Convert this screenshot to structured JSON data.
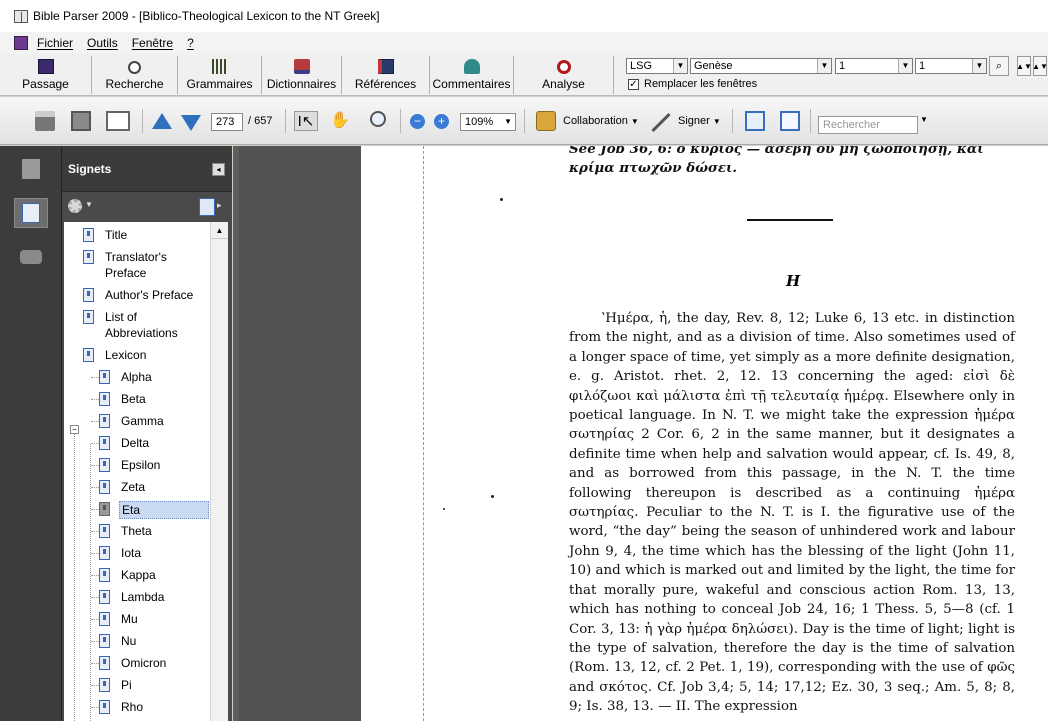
{
  "window": {
    "title": "Bible Parser 2009 - [Biblico-Theological Lexicon to the NT Greek]"
  },
  "menu": {
    "items": [
      "Fichier",
      "Outils",
      "Fenêtre",
      "?"
    ]
  },
  "app_toolbar": {
    "buttons": [
      {
        "label": "Passage",
        "icon": "book-icon"
      },
      {
        "label": "Recherche",
        "icon": "search-icon"
      },
      {
        "label": "Grammaires",
        "icon": "grammar-icon"
      },
      {
        "label": "Dictionnaires",
        "icon": "dictionary-icon"
      },
      {
        "label": "Références",
        "icon": "references-icon"
      },
      {
        "label": "Commentaires",
        "icon": "commentary-icon"
      },
      {
        "label": "Analyse",
        "icon": "analyse-icon"
      }
    ],
    "version_select": "LSG",
    "book_select": "Genèse",
    "chapter_select": "1",
    "verse_select": "1",
    "replace_windows_label": "Remplacer les fenêtres",
    "replace_windows_checked": true
  },
  "pdf_toolbar": {
    "current_page": "273",
    "total_pages": "/ 657",
    "zoom": "109%",
    "collaboration_label": "Collaboration",
    "sign_label": "Signer",
    "search_placeholder": "Rechercher"
  },
  "bookmarks": {
    "title": "Signets",
    "items": [
      {
        "label": "Title",
        "level": 0
      },
      {
        "label": "Translator's Preface",
        "level": 0
      },
      {
        "label": "Author's Preface",
        "level": 0
      },
      {
        "label": "List of Abbreviations",
        "level": 0
      },
      {
        "label": "Lexicon",
        "level": 0,
        "expanded": true
      },
      {
        "label": "Alpha",
        "level": 1
      },
      {
        "label": "Beta",
        "level": 1
      },
      {
        "label": "Gamma",
        "level": 1
      },
      {
        "label": "Delta",
        "level": 1
      },
      {
        "label": "Epsilon",
        "level": 1
      },
      {
        "label": "Zeta",
        "level": 1
      },
      {
        "label": "Eta",
        "level": 1,
        "selected": true
      },
      {
        "label": "Theta",
        "level": 1
      },
      {
        "label": "Iota",
        "level": 1
      },
      {
        "label": "Kappa",
        "level": 1
      },
      {
        "label": "Lambda",
        "level": 1
      },
      {
        "label": "Mu",
        "level": 1
      },
      {
        "label": "Nu",
        "level": 1
      },
      {
        "label": "Omicron",
        "level": 1
      },
      {
        "label": "Pi",
        "level": 1
      },
      {
        "label": "Rho",
        "level": 1
      }
    ]
  },
  "document": {
    "top_line_1": "See Job 36, 6: ὁ κύριος — ἀσεβῆ οὐ μὴ ζωοποιήσῃ, καὶ",
    "top_line_2": "κρίμα πτωχῶν δώσει.",
    "section_letter": "H",
    "paragraph": "ʽΗμέρα, ἡ, the day, Rev. 8, 12; Luke 6, 13 etc. in distinction from the night, and as a division of time. Also sometimes used of a longer space of time, yet simply as a more definite designation, e. g. Aristot. rhet. 2, 12. 13 concerning the aged: εἰσὶ δὲ φιλόζωοι καὶ μάλιστα ἐπὶ τῇ τελευταίᾳ ἡμέρᾳ. Elsewhere only in poetical language. In N. T. we might take the expression ἡμέρα σωτηρίας 2 Cor. 6, 2 in the same manner, but it designates a definite time when help and salvation would appear, cf. Is. 49, 8, and as borrowed from this passage, in the N. T. the time following thereupon is described as a continuing ἡμέρα σωτηρίας. Peculiar to the N. T. is I. the figurative use of the word, “the day” being the season of unhindered work and labour John 9, 4, the time which has the blessing of the light (John 11, 10) and which is marked out and limited by the light, the time for that morally pure, wakeful and conscious action Rom. 13, 13, which has nothing to conceal Job 24, 16; 1 Thess. 5, 5—8 (cf. 1 Cor. 3, 13: ἡ γὰρ ἡμέρα δηλώσει). Day is the time of light; light is the type of salvation, therefore the day is the time of salvation (Rom. 13, 12, cf. 2 Pet. 1, 19), corresponding with the use of φῶς and σκότος. Cf. Job 3,4; 5, 14; 17,12; Ez. 30, 3 seq.; Am. 5, 8; 8, 9; Is. 38, 13. — II. The expression"
  }
}
